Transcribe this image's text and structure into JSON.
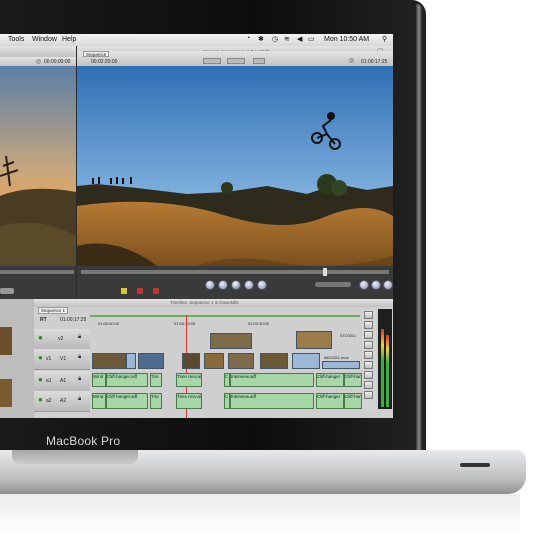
{
  "menubar": {
    "items": [
      "Tools",
      "Window",
      "Help"
    ],
    "time": "Mon 10:50 AM"
  },
  "canvas": {
    "title": "Canvas: Sequence 1 in Downhills",
    "tab": "Sequence",
    "timecode": "00:02:20:00",
    "right_timecode": "01:00:17:25"
  },
  "viewer": {
    "timecode": "00:00:00:00"
  },
  "timeline": {
    "title": "Timeline: Sequence 1 in Downhills",
    "tab": "Sequence 1",
    "rt_label": "RT",
    "timecode": "01:00:17:25",
    "ruler": [
      "01:00:00:00",
      "01:00:15:00",
      "01:00:30:00"
    ],
    "tracks": [
      {
        "a": "v2",
        "b": ""
      },
      {
        "a": "v1",
        "b": "V1"
      },
      {
        "a": "a1",
        "b": "A1"
      },
      {
        "a": "a2",
        "b": "A2"
      }
    ],
    "video_clip_labels": [
      "07C0011",
      "68C0011.mov"
    ],
    "audio_clips_a1": [
      "Wind",
      "Cliff-hanger.aiff",
      "Tire",
      "Tires revv.aiff",
      "C",
      "Interview.aiff",
      "Cliff-hanger",
      "Cliff-hanger"
    ],
    "audio_clips_a2": [
      "Wind",
      "Cliff-hanger.aiff",
      "Tire",
      "Tires revv.aiff",
      "C",
      "Interview.aiff",
      "Cliff-hanger",
      "Cliff-hanger"
    ]
  },
  "laptop": {
    "brand": "MacBook Pro"
  },
  "colors": {
    "video_clip": "#9db8d6",
    "audio_clip": "#a7d6a7",
    "bezel": "#111111"
  }
}
